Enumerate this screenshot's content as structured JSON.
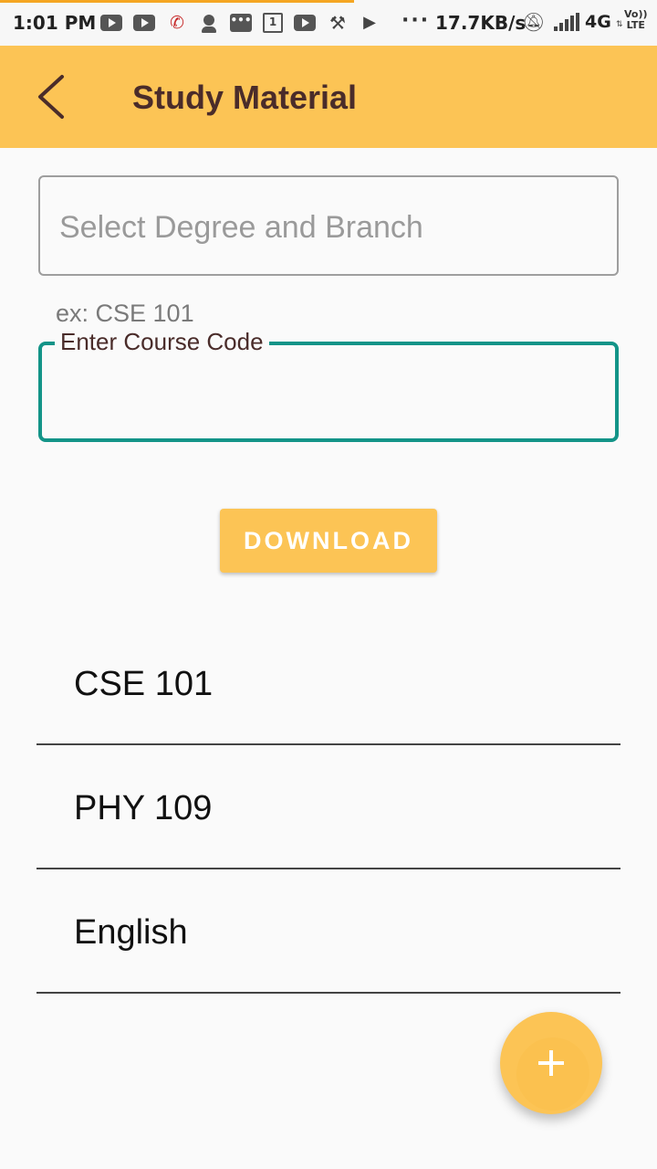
{
  "status_bar": {
    "time": "1:01 PM",
    "notification_icons": [
      "youtube-icon",
      "youtube-icon",
      "missed-call-icon",
      "person-icon",
      "message-icon",
      "calendar-icon",
      "youtube-icon",
      "hammer-icon",
      "play-store-icon"
    ],
    "calendar_day": "1",
    "more_indicator": "···",
    "network_speed": "17.7KB/s",
    "network_type": "4G",
    "volte_line1": "Vo))",
    "volte_line2": "LTE"
  },
  "app_bar": {
    "title": "Study Material",
    "color": "#fcc455",
    "title_color": "#4a2c2a"
  },
  "form": {
    "degree_placeholder": "Select Degree and Branch",
    "course_helper": "ex: CSE 101",
    "course_label": "Enter Course Code",
    "course_value": "",
    "accent_color": "#139488",
    "download_label": "DOWNLOAD"
  },
  "courses": [
    {
      "label": "CSE 101"
    },
    {
      "label": "PHY 109"
    },
    {
      "label": "English"
    }
  ],
  "fab": {
    "icon": "plus-icon",
    "color": "#fcc455"
  }
}
